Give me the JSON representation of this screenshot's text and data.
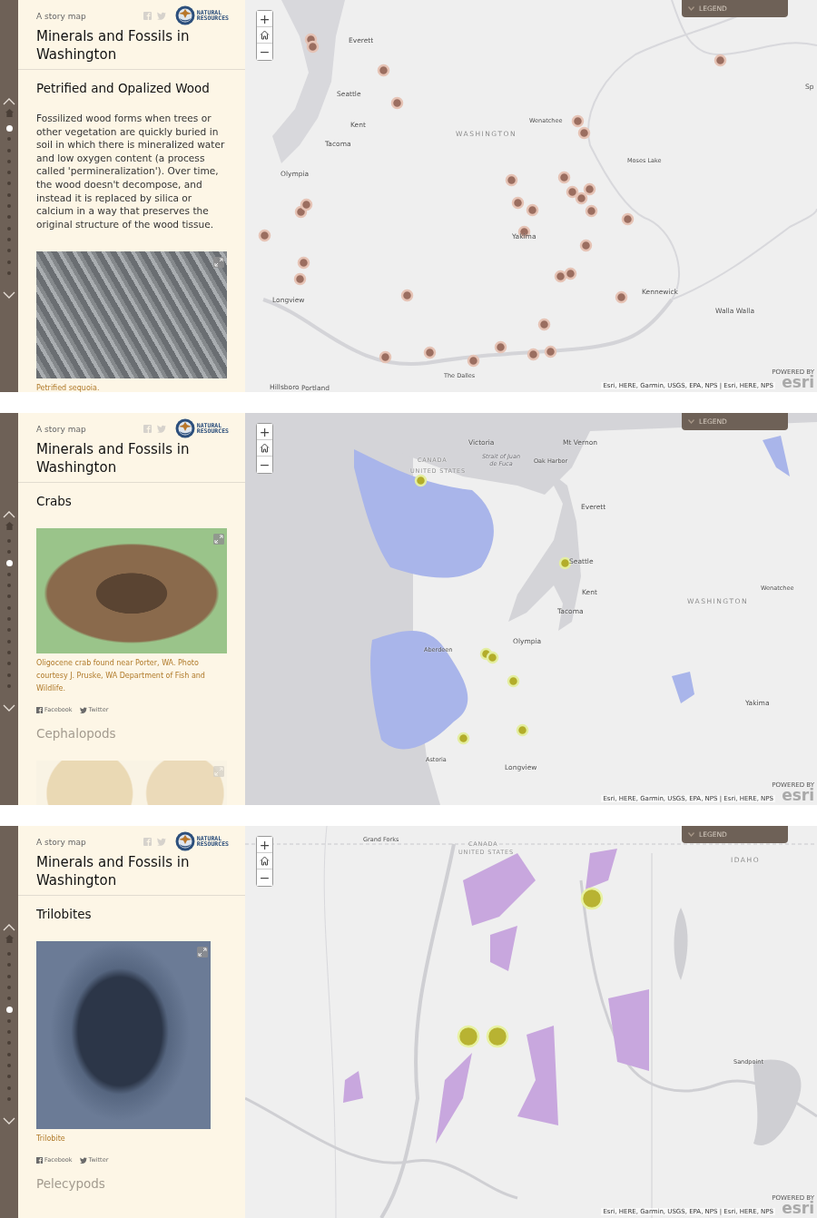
{
  "panels": [
    {
      "nav": {
        "dots": [
          {
            "selected": true
          },
          {
            "selected": false
          },
          {
            "selected": false
          },
          {
            "selected": false
          },
          {
            "selected": false
          },
          {
            "selected": false
          },
          {
            "selected": false
          },
          {
            "selected": false
          },
          {
            "selected": false
          },
          {
            "selected": false
          },
          {
            "selected": false
          },
          {
            "selected": false
          },
          {
            "selected": false
          },
          {
            "selected": false
          }
        ]
      },
      "header": {
        "eyebrow": "A story map",
        "title": "Minerals and Fossils in Washington",
        "logo_lines": [
          "NATURAL",
          "RESOURCES"
        ]
      },
      "sections": [
        {
          "heading": "Petrified and Opalized Wood",
          "faded": false,
          "body": "Fossilized wood forms when trees or other vegetation are quickly buried in soil in which there is mineralized water and low oxygen content (a process called 'permineralization'). Over time, the wood doesn't decompose, and instead it is replaced by silica or calcium in a way that preserves the original structure of the wood tissue.",
          "image": {
            "kind": "wood"
          },
          "caption": "Petrified sequoia."
        }
      ],
      "map": {
        "kind": "sites",
        "zoom_in": "+",
        "zoom_out": "−",
        "legend": "LEGEND",
        "attribution": "Esri, HERE, Garmin, USGS, EPA, NPS | Esri, HERE, NPS",
        "logo": "esri",
        "logo_caption": "POWERED BY",
        "labels": [
          {
            "text": "Everett",
            "kind": "city"
          },
          {
            "text": "Seattle",
            "kind": "city"
          },
          {
            "text": "Kent",
            "kind": "city"
          },
          {
            "text": "Tacoma",
            "kind": "city"
          },
          {
            "text": "Olympia",
            "kind": "city"
          },
          {
            "text": "WASHINGTON",
            "kind": "region"
          },
          {
            "text": "Wenatchee",
            "kind": "town"
          },
          {
            "text": "Moses Lake",
            "kind": "town"
          },
          {
            "text": "Yakima",
            "kind": "city"
          },
          {
            "text": "Kennewick",
            "kind": "city"
          },
          {
            "text": "Walla Walla",
            "kind": "city"
          },
          {
            "text": "Longview",
            "kind": "city"
          },
          {
            "text": "The Dalles",
            "kind": "town"
          },
          {
            "text": "Hillsboro",
            "kind": "city"
          },
          {
            "text": "Portland",
            "kind": "city"
          },
          {
            "text": "Sp",
            "kind": "city"
          }
        ]
      }
    },
    {
      "nav": {
        "dots": [
          {
            "selected": false
          },
          {
            "selected": false
          },
          {
            "selected": true
          },
          {
            "selected": false
          },
          {
            "selected": false
          },
          {
            "selected": false
          },
          {
            "selected": false
          },
          {
            "selected": false
          },
          {
            "selected": false
          },
          {
            "selected": false
          },
          {
            "selected": false
          },
          {
            "selected": false
          },
          {
            "selected": false
          },
          {
            "selected": false
          }
        ]
      },
      "header": {
        "eyebrow": "A story map",
        "title": "Minerals and Fossils in Washington",
        "logo_lines": [
          "NATURAL",
          "RESOURCES"
        ]
      },
      "sections": [
        {
          "heading": "Crabs",
          "faded": false,
          "image": {
            "kind": "crab"
          },
          "caption": "Oligocene crab found near Porter, WA. Photo courtesy J. Pruske, WA Department of Fish and Wildlife.",
          "share": [
            "Facebook",
            "Twitter"
          ]
        },
        {
          "heading": "Cephalopods",
          "faded": true,
          "image": {
            "kind": "ammonite"
          }
        }
      ],
      "map": {
        "kind": "coastal",
        "zoom_in": "+",
        "zoom_out": "−",
        "legend": "LEGEND",
        "attribution": "Esri, HERE, Garmin, USGS, EPA, NPS | Esri, HERE, NPS",
        "logo": "esri",
        "logo_caption": "POWERED BY",
        "labels": [
          {
            "text": "Victoria",
            "kind": "city"
          },
          {
            "text": "Mt Vernon",
            "kind": "city"
          },
          {
            "text": "CANADA",
            "kind": "border"
          },
          {
            "text": "UNITED STATES",
            "kind": "border"
          },
          {
            "text": "Strait of Juan de Fuca",
            "kind": "water"
          },
          {
            "text": "Oak Harbor",
            "kind": "town"
          },
          {
            "text": "Everett",
            "kind": "city"
          },
          {
            "text": "Seattle",
            "kind": "city"
          },
          {
            "text": "Kent",
            "kind": "city"
          },
          {
            "text": "Tacoma",
            "kind": "city"
          },
          {
            "text": "Olympia",
            "kind": "city"
          },
          {
            "text": "Aberdeen",
            "kind": "town"
          },
          {
            "text": "Astoria",
            "kind": "town"
          },
          {
            "text": "Longview",
            "kind": "city"
          },
          {
            "text": "WASHINGTON",
            "kind": "region"
          },
          {
            "text": "Wenatchee",
            "kind": "town"
          },
          {
            "text": "Yakima",
            "kind": "city"
          }
        ]
      }
    },
    {
      "nav": {
        "dots": [
          {
            "selected": false
          },
          {
            "selected": false
          },
          {
            "selected": false
          },
          {
            "selected": false
          },
          {
            "selected": false
          },
          {
            "selected": true
          },
          {
            "selected": false
          },
          {
            "selected": false
          },
          {
            "selected": false
          },
          {
            "selected": false
          },
          {
            "selected": false
          },
          {
            "selected": false
          },
          {
            "selected": false
          },
          {
            "selected": false
          }
        ]
      },
      "header": {
        "eyebrow": "A story map",
        "title": "Minerals and Fossils in Washington",
        "logo_lines": [
          "NATURAL",
          "RESOURCES"
        ]
      },
      "sections": [
        {
          "heading": "Trilobites",
          "faded": false,
          "image": {
            "kind": "trilobite"
          },
          "caption": "Trilobite",
          "share": [
            "Facebook",
            "Twitter"
          ]
        },
        {
          "heading": "Pelecypods",
          "faded": true
        }
      ],
      "map": {
        "kind": "northeast",
        "zoom_in": "+",
        "zoom_out": "−",
        "legend": "LEGEND",
        "attribution": "Esri, HERE, Garmin, USGS, EPA, NPS | Esri, HERE, NPS",
        "logo": "esri",
        "logo_caption": "POWERED BY",
        "labels": [
          {
            "text": "Grand Forks",
            "kind": "town"
          },
          {
            "text": "CANADA",
            "kind": "border"
          },
          {
            "text": "UNITED STATES",
            "kind": "border"
          },
          {
            "text": "IDAHO",
            "kind": "region"
          },
          {
            "text": "Sandpoint",
            "kind": "town"
          }
        ]
      }
    }
  ]
}
